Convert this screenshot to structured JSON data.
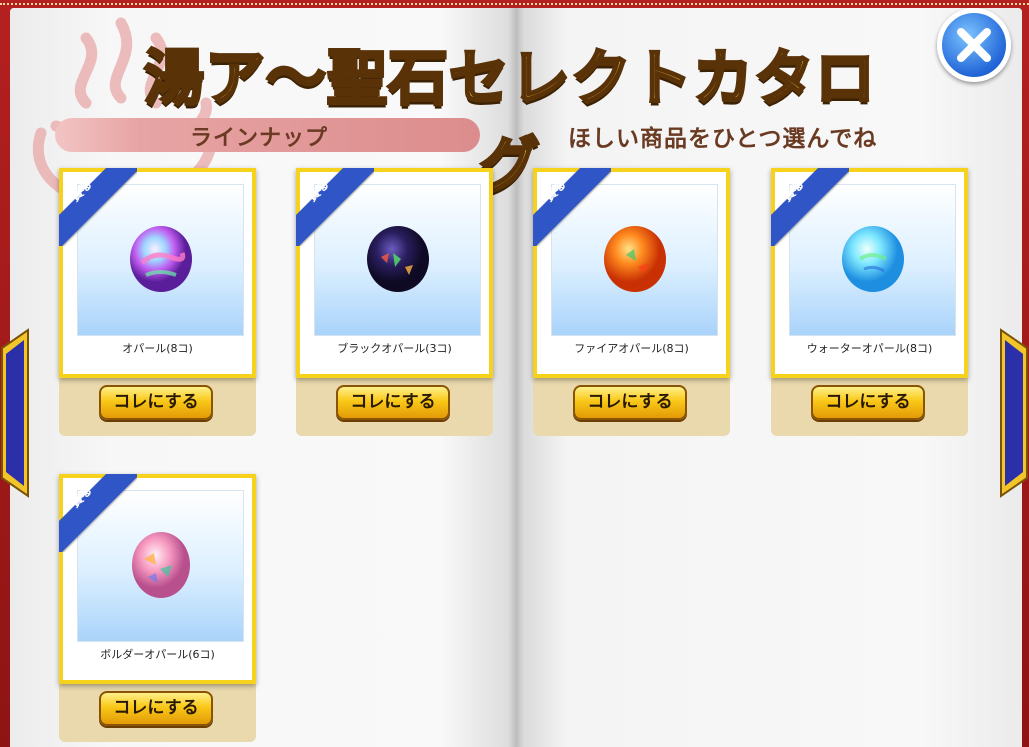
{
  "header": {
    "title": "湯ア〜聖石セレクトカタログ"
  },
  "lineup_label": "ラインナップ",
  "instruction": "ほしい商品をひとつ選んでね",
  "items": [
    {
      "name": "オパール(8コ)",
      "ribbon": "貰る",
      "button": "コレにする",
      "gem": "opal"
    },
    {
      "name": "ブラックオパール(3コ)",
      "ribbon": "貰る",
      "button": "コレにする",
      "gem": "black-opal"
    },
    {
      "name": "ファイアオパール(8コ)",
      "ribbon": "貰る",
      "button": "コレにする",
      "gem": "fire-opal"
    },
    {
      "name": "ウォーターオパール(8コ)",
      "ribbon": "貰る",
      "button": "コレにする",
      "gem": "water-opal"
    },
    {
      "name": "ボルダーオパール(6コ)",
      "ribbon": "貰る",
      "button": "コレにする",
      "gem": "boulder-opal"
    }
  ],
  "colors": {
    "frame_red": "#a81c1c",
    "title_gold": "#ffd84a",
    "button_gold": "#f9c818",
    "ribbon_blue": "#2f55c6",
    "nav_arrow": "#2b2fa8"
  },
  "icons": [
    "onsen-icon",
    "close-icon",
    "prev-arrow-icon",
    "next-arrow-icon"
  ]
}
